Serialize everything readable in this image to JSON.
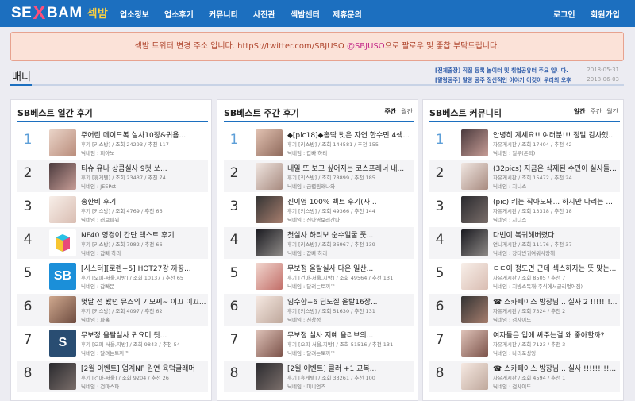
{
  "logo": {
    "part1": "SE",
    "x": "X",
    "part2": "BAM",
    "kr": "섹밤"
  },
  "nav": [
    "업소정보",
    "업소후기",
    "커뮤니티",
    "사진관",
    "섹밤센터",
    "제휴문의"
  ],
  "auth": {
    "login": "로그인",
    "signup": "회원가입"
  },
  "notice": {
    "before": "섹밤 트위터 변경 주소 입니다. httpS://twitter.com/SBJUSO ",
    "mention": "@SBJUSO",
    "after": "으로 팔로우 및 좋찹 부탁드립니다."
  },
  "banner": {
    "title": "배너"
  },
  "ticker": [
    {
      "text": "[전체출장] 직접 등록 놀이터 및 취업공유터 주요 입니다.",
      "date": "2018-05-31"
    },
    {
      "text": "[말랑공주] 말랑 공주 정신적인 이야기 이것이 우리의 오후",
      "date": "2018-06-03"
    }
  ],
  "panels": [
    {
      "title": "SB베스트 일간 후기",
      "tabs": [],
      "rows": [
        {
          "rank": "1",
          "title": "주어린 메이드복 실사10장&귀욤...",
          "cat": "후기 [키스방]",
          "views": "조회 24293",
          "rec": "추천 117",
          "nick": "닉네임 : 피아노"
        },
        {
          "rank": "2",
          "title": "티슈 유나 상큼실사 9컷 쏘...",
          "cat": "후기 [휴게텔]",
          "views": "조회 23437",
          "rec": "추천 74",
          "nick": "닉네임 : JEEPst"
        },
        {
          "rank": "3",
          "title": "송한비 후기",
          "cat": "후기 [키스방]",
          "views": "조회 4769",
          "rec": "추천 66",
          "nick": "닉네임 : 러브파워"
        },
        {
          "rank": "4",
          "title": "NF40 영경이 간단 텍스트 후기",
          "cat": "후기 [키스방]",
          "views": "조회 7982",
          "rec": "추천 66",
          "nick": "닉네임 : 갑빠 하리"
        },
        {
          "rank": "5",
          "title": "[시스터][로렌+5] HOT27강 까꿍...",
          "cat": "후기 [오피-서울,지방]",
          "views": "조회 10137",
          "rec": "추천 65",
          "nick": "닉네임 : 갑빠문"
        },
        {
          "rank": "6",
          "title": "몇달 전 봤던 뮤즈의 기모찌~ 이끄 이끄...",
          "cat": "후기 [키스방]",
          "views": "조회 4097",
          "rec": "추천 62",
          "nick": "닉네임 : 파홀"
        },
        {
          "rank": "7",
          "title": "무보정 올탈실사 귀요미 뒷...",
          "cat": "후기 [오피-서울,지방]",
          "views": "조회 9843",
          "rec": "추천 54",
          "nick": "닉네임 : 달려는토끼™"
        },
        {
          "rank": "8",
          "title": "[2월 이벤트] 업계NF 원연 육덕글래머",
          "cat": "후기 [건마-서울]",
          "views": "조회 9204",
          "rec": "추천 26",
          "nick": "닉네임 : 건마스파"
        }
      ]
    },
    {
      "title": "SB베스트 주간 후기",
      "tabs": [
        "주간",
        "월간"
      ],
      "rows": [
        {
          "rank": "1",
          "title": "◆[pic18]◆홀딱 벗은 자연 한수민 4색...",
          "cat": "후기 [키스방]",
          "views": "조회 144581",
          "rec": "추천 155",
          "nick": "닉네임 : 갑빠 하리"
        },
        {
          "rank": "2",
          "title": "내일 또 보고 싶어지는 코스프레너 내...",
          "cat": "후기 [키스방]",
          "views": "조회 78899",
          "rec": "추천 185",
          "nick": "닉네임 : 금렵림왜나와"
        },
        {
          "rank": "3",
          "title": "진이영 100% 백트 후기(사...",
          "cat": "후기 [키스방]",
          "views": "조회 49366",
          "rec": "추천 144",
          "nick": "닉네임 : 진아영보러간다"
        },
        {
          "rank": "4",
          "title": "첫실사 하리보 순수얼굴 풋...",
          "cat": "후기 [키스방]",
          "views": "조회 36967",
          "rec": "추천 139",
          "nick": "닉네임 : 갑빠 하리"
        },
        {
          "rank": "5",
          "title": "무보정 올탈실사 다은 일산...",
          "cat": "후기 [건마-서울,지방]",
          "views": "조회 49564",
          "rec": "추천 131",
          "nick": "닉네임 : 달려는토끼™"
        },
        {
          "rank": "6",
          "title": "임수향+6 딥도질 올탈16장...",
          "cat": "후기 [키스방]",
          "views": "조회 51630",
          "rec": "추천 131",
          "nick": "닉네임 : 친창성"
        },
        {
          "rank": "7",
          "title": "무보정 실사 지예 올리브의...",
          "cat": "후기 [오피-서울,지방]",
          "views": "조회 51516",
          "rec": "추천 131",
          "nick": "닉네임 : 달려는토끼™"
        },
        {
          "rank": "8",
          "title": "[2월 이벤트] 클러 +1 교복...",
          "cat": "후기 [휴게텔]",
          "views": "조회 33261",
          "rec": "추천 100",
          "nick": "닉네임 : 미니언즈"
        }
      ]
    },
    {
      "title": "SB베스트 커뮤니티",
      "tabs": [
        "일간",
        "주간",
        "월간"
      ],
      "rows": [
        {
          "rank": "1",
          "title": "안녕히 계세요!! 여러분!!! 정말 감사했...",
          "cat": "자유게시판",
          "views": "조회 17404",
          "rec": "추천 42",
          "nick": "닉네임 : 일부(은퇴)"
        },
        {
          "rank": "2",
          "title": "(32pics) 지금은 삭제된 수민이 실사들...",
          "cat": "자유게시판",
          "views": "조회 15472",
          "rec": "추천 24",
          "nick": "닉네임 : 지니스"
        },
        {
          "rank": "3",
          "title": "(pic) 키는 작아도돼... 하지만 다리는 ...",
          "cat": "자유게시판",
          "views": "조회 13318",
          "rec": "추천 18",
          "nick": "닉네임 : 지니스"
        },
        {
          "rank": "4",
          "title": "다빈이 복귀해버렸다",
          "cat": "언니게시판",
          "views": "조회 11176",
          "rec": "추천 37",
          "nick": "닉네임 : 장다빈귀여워사랑해"
        },
        {
          "rank": "5",
          "title": "ㄷㄷ이 정도면 근데 섹스하자는 뜻 맞는...",
          "cat": "자유게시판",
          "views": "조회 8505",
          "rec": "추천 7",
          "nick": "닉네임 : 지방스독재(주식에서글리멀어짐)"
        },
        {
          "rank": "6",
          "title": "☎ 스카페이스 방장님 .. 실사 2 !!!!!!!...",
          "cat": "자유게시판",
          "views": "조회 7324",
          "rec": "추천 2",
          "nick": "닉네임 : 검사이드"
        },
        {
          "rank": "7",
          "title": "여자들은 입에 싸주는걸 왜 좋아할까?",
          "cat": "자유게시판",
          "views": "조회 7123",
          "rec": "추천 3",
          "nick": "닉네임 : 나리포싱잉"
        },
        {
          "rank": "8",
          "title": "☎ 스카페이스 방장님 .. 실사 !!!!!!!!!...",
          "cat": "자유게시판",
          "views": "조회 4594",
          "rec": "추천 1",
          "nick": "닉네임 : 검사이드"
        }
      ]
    }
  ],
  "colors": {
    "navbar": "#1c6fbf",
    "notice_bg": "#fbe2d8",
    "accent_pink": "#ff4f7a",
    "heart": "#e0284f"
  }
}
